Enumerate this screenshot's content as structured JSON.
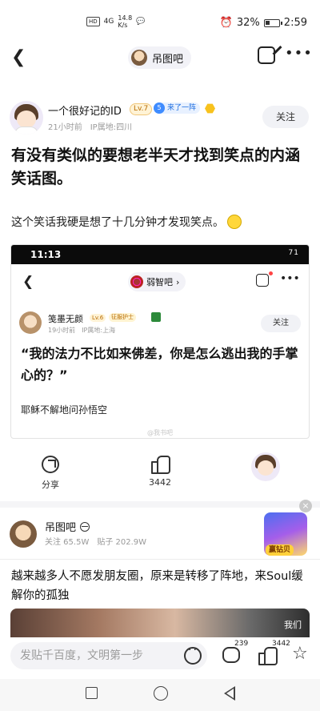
{
  "status_bar": {
    "left_chip": "HD",
    "network": "4G",
    "speed": "14.8",
    "speed_unit": "K/s",
    "battery_text": "32%",
    "battery_level": 0.32,
    "time": "2:59"
  },
  "nav": {
    "forum_name": "吊图吧"
  },
  "author": {
    "name": "一个很好记的ID",
    "level": "Lv.7",
    "badge_num": "5",
    "badge_text": "来了一阵",
    "time": "21小时前",
    "location": "IP属地:四川",
    "follow_label": "关注"
  },
  "post": {
    "title": "有没有类似的要想老半天才找到笑点的内涵笑话图。",
    "body": "这个笑话我硬是想了十几分钟才发现笑点。"
  },
  "embedded": {
    "status_time": "11:13",
    "status_right": "71",
    "forum_name": "弱智吧",
    "user_name": "笺墨无颜",
    "level": "Lv.6",
    "badge": "征服护士",
    "time": "19小时前",
    "location": "IP属地:上海",
    "follow_label": "关注",
    "quote": "“我的法力不比如来佛差，你是怎么逃出我的手掌心的？”",
    "caption": "耶稣不解地问孙悟空",
    "watermark": "@我书吧"
  },
  "actions": {
    "share_label": "分享",
    "like_count": "3442"
  },
  "forum_card": {
    "name": "吊图吧",
    "followers": "关注 65.5W",
    "posts": "贴子 202.9W",
    "ad_label": "赢钻贝",
    "ad_close": "×"
  },
  "feed": {
    "title": "越来越多人不愿发朋友圈，原来是转移了阵地，来Soul缓解你的孤独",
    "img_text": "我们"
  },
  "reply_bar": {
    "placeholder": "发贴千百度，文明第一步",
    "comment_count": "239",
    "like_count": "3442"
  },
  "icons": {
    "back": "back-arrow-icon",
    "edit": "edit-icon",
    "more": "more-icon",
    "share": "share-icon",
    "like": "thumb-up-icon",
    "star": "star-icon"
  }
}
